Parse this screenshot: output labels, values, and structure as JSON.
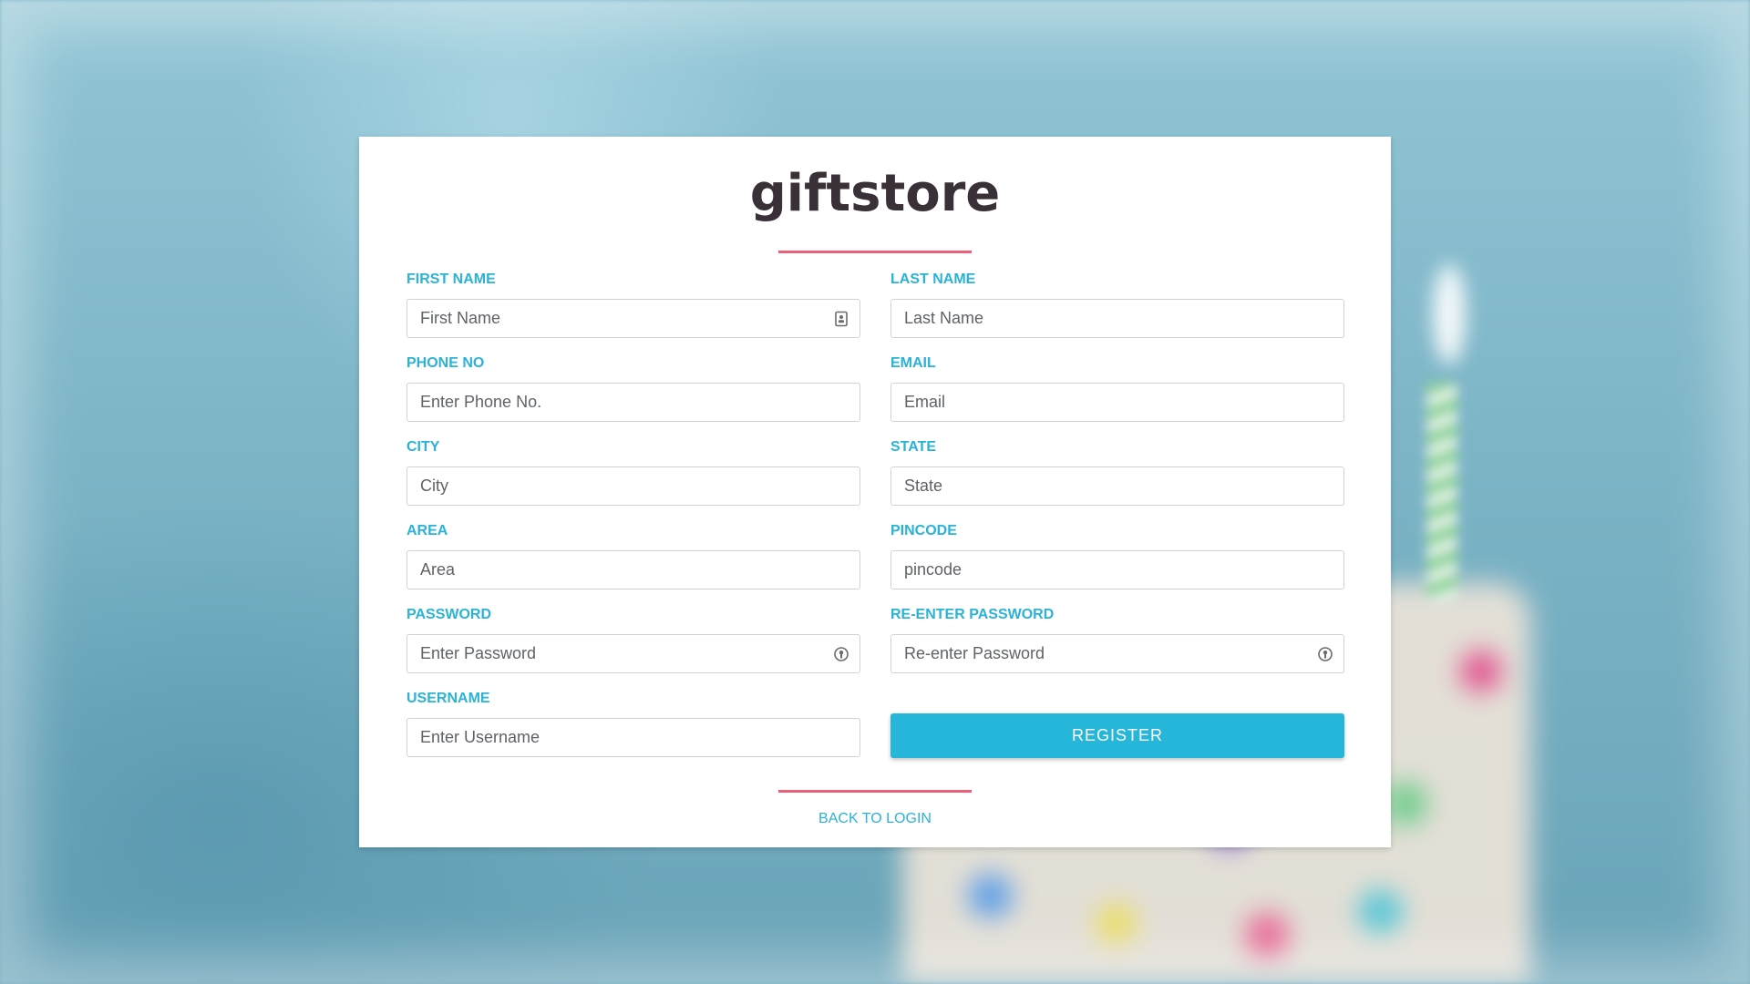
{
  "brand": {
    "logo_text": "giftstore",
    "accent_color": "#ea5f79",
    "primary_color": "#25b6da"
  },
  "form": {
    "first_name": {
      "label": "FIRST NAME",
      "placeholder": "First Name",
      "value": "",
      "icon": "contact-card-icon"
    },
    "last_name": {
      "label": "LAST NAME",
      "placeholder": "Last Name",
      "value": ""
    },
    "phone": {
      "label": "PHONE NO",
      "placeholder": "Enter Phone No.",
      "value": ""
    },
    "email": {
      "label": "EMAIL",
      "placeholder": "Email",
      "value": ""
    },
    "city": {
      "label": "CITY",
      "placeholder": "City",
      "value": ""
    },
    "state": {
      "label": "STATE",
      "placeholder": "State",
      "value": ""
    },
    "area": {
      "label": "AREA",
      "placeholder": "Area",
      "value": ""
    },
    "pincode": {
      "label": "PINCODE",
      "placeholder": "pincode",
      "value": ""
    },
    "password": {
      "label": "PASSWORD",
      "placeholder": "Enter Password",
      "value": "",
      "icon": "password-key-icon"
    },
    "reenter_password": {
      "label": "RE-ENTER PASSWORD",
      "placeholder": "Re-enter Password",
      "value": "",
      "icon": "password-key-icon"
    },
    "username": {
      "label": "USERNAME",
      "placeholder": "Enter Username",
      "value": ""
    },
    "register_label": "REGISTER"
  },
  "footer": {
    "back_to_login_label": "BACK TO LOGIN"
  }
}
